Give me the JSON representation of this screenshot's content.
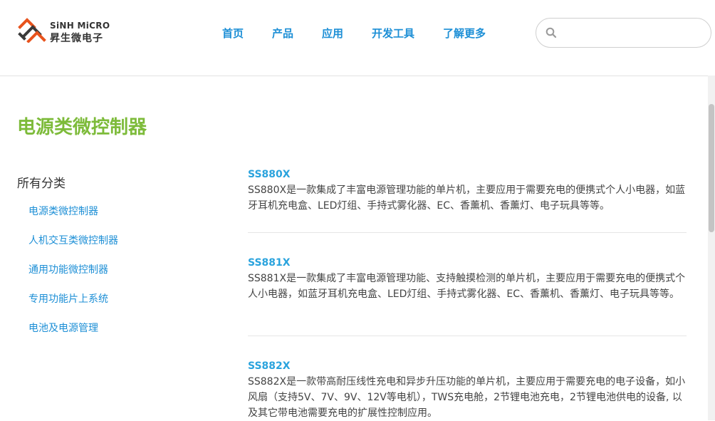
{
  "header": {
    "brand_en": "SiNH MiCRO",
    "brand_cn": "昇生微电子",
    "nav": [
      {
        "label": "首页"
      },
      {
        "label": "产品"
      },
      {
        "label": "应用"
      },
      {
        "label": "开发工具"
      },
      {
        "label": "了解更多"
      }
    ],
    "search": {
      "placeholder": "",
      "icon": "search-icon"
    }
  },
  "page": {
    "title": "电源类微控制器"
  },
  "sidebar": {
    "heading": "所有分类",
    "items": [
      {
        "label": "电源类微控制器"
      },
      {
        "label": "人机交互类微控制器"
      },
      {
        "label": "通用功能微控制器"
      },
      {
        "label": "专用功能片上系统"
      },
      {
        "label": "电池及电源管理"
      }
    ]
  },
  "products": [
    {
      "name": "SS880X",
      "desc": "SS880X是一款集成了丰富电源管理功能的单片机，主要应用于需要充电的便携式个人小电器，如蓝牙耳机充电盒、LED灯组、手持式雾化器、EC、香薰机、香薰灯、电子玩具等等。"
    },
    {
      "name": "SS881X",
      "desc": "SS881X是一款集成了丰富电源管理功能、支持触摸检测的单片机，主要应用于需要充电的便携式个人小电器，如蓝牙耳机充电盒、LED灯组、手持式雾化器、EC、香薰机、香薰灯、电子玩具等等。"
    },
    {
      "name": "SS882X",
      "desc": "SS882X是一款带高耐压线性充电和异步升压功能的单片机，主要应用于需要充电的电子设备，如小风扇（支持5V、7V、9V、12V等电机），TWS充电舱，2节锂电池充电，2节锂电池供电的设备, 以及其它带电池需要充电的扩展性控制应用。"
    }
  ],
  "colors": {
    "accent_green": "#7dbb3a",
    "link_blue": "#1d8fd6",
    "product_blue": "#2aa3dd"
  }
}
